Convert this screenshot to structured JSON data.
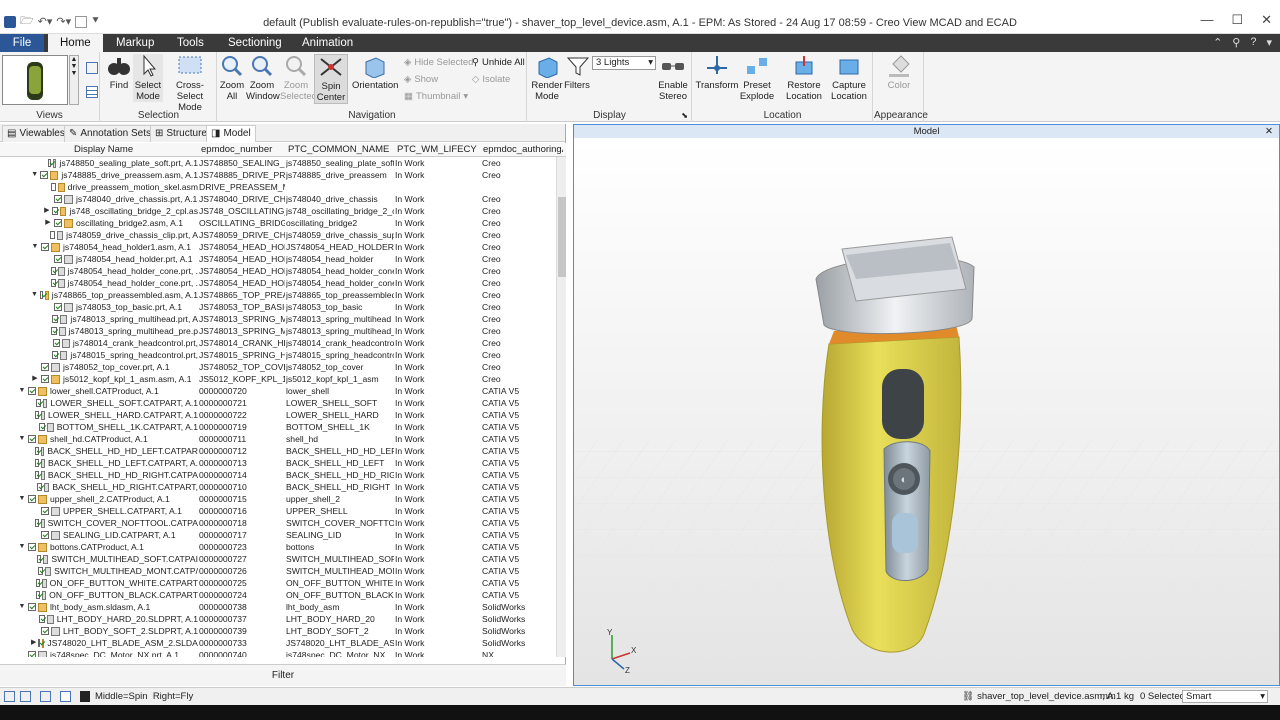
{
  "window": {
    "title": "default (Publish evaluate-rules-on-republish=\"true\") - shaver_top_level_device.asm, A.1 - EPM: As Stored - 24 Aug 17 08:59 - Creo View MCAD and ECAD"
  },
  "tabs": [
    "File",
    "Home",
    "Markup",
    "Tools",
    "Sectioning",
    "Animation"
  ],
  "ribbon": {
    "groups": [
      "Views",
      "Selection",
      "Navigation",
      "Display",
      "Location",
      "Appearance"
    ],
    "find": "Find",
    "select_mode": "Select Mode",
    "cross_select": "Cross-Select Mode",
    "zoom_all": "Zoom All",
    "zoom_window": "Zoom Window",
    "zoom_selected": "Zoom Selected",
    "spin_center": "Spin Center",
    "orientation": "Orientation",
    "hide_selected": "Hide Selected",
    "show": "Show",
    "thumbnail": "Thumbnail",
    "unhide_all": "Unhide All",
    "isolate": "Isolate",
    "render_mode": "Render Mode",
    "filters": "Filters",
    "lights_value": "3 Lights",
    "enable_stereo": "Enable Stereo",
    "transform": "Transform",
    "preset_explode": "Preset Explode",
    "restore_location": "Restore Location",
    "capture_location": "Capture Location",
    "color": "Color"
  },
  "panel": {
    "tabs": [
      "Viewables",
      "Annotation Sets",
      "Structure",
      "Model"
    ],
    "columns": [
      "Display Name",
      "epmdoc_number",
      "PTC_COMMON_NAME",
      "PTC_WM_LIFECYCL...",
      "epmdoc_authoringA..."
    ],
    "filter_label": "Filter"
  },
  "rows": [
    {
      "d": 2,
      "e": "",
      "cb": true,
      "t": "part",
      "n": "js748850_sealing_plate_soft.prt, A.1",
      "num": "JS748850_SEALING_PL...",
      "cn": "js748850_sealing_plate_soft",
      "lc": "In Work",
      "a": "Creo"
    },
    {
      "d": 1,
      "e": "▼",
      "cb": true,
      "t": "asm",
      "n": "js748885_drive_preassem.asm, A.1",
      "num": "JS748885_DRIVE_PREA...",
      "cn": "js748885_drive_preassem",
      "lc": "In Work",
      "a": "Creo"
    },
    {
      "d": 2,
      "e": "",
      "cb": false,
      "t": "asm",
      "n": "drive_preassem_motion_skel.asm",
      "num": "DRIVE_PREASSEM_MO...",
      "cn": "",
      "lc": "",
      "a": ""
    },
    {
      "d": 2,
      "e": "",
      "cb": true,
      "t": "part",
      "n": "js748040_drive_chassis.prt, A.1",
      "num": "JS748040_DRIVE_CHAS...",
      "cn": "js748040_drive_chassis",
      "lc": "In Work",
      "a": "Creo"
    },
    {
      "d": 2,
      "e": "▶",
      "cb": true,
      "t": "asm",
      "n": "js748_oscillating_bridge_2_cpl.as",
      "num": "JS748_OSCILLATING_B...",
      "cn": "js748_oscillating_bridge_2_cpl",
      "lc": "In Work",
      "a": "Creo"
    },
    {
      "d": 2,
      "e": "▶",
      "cb": true,
      "t": "asm",
      "n": "oscillating_bridge2.asm, A.1",
      "num": "OSCILLATING_BRIDGE2",
      "cn": "oscillating_bridge2",
      "lc": "In Work",
      "a": "Creo"
    },
    {
      "d": 2,
      "e": "",
      "cb": false,
      "t": "part",
      "n": "js748059_drive_chassis_clip.prt, A",
      "num": "JS748059_DRIVE_CHAS...",
      "cn": "js748059_drive_chassis_supp...",
      "lc": "In Work",
      "a": "Creo"
    },
    {
      "d": 1,
      "e": "▼",
      "cb": true,
      "t": "asm",
      "n": "js748054_head_holder1.asm, A.1",
      "num": "JS748054_HEAD_HOLD...",
      "cn": "JS748054_HEAD_HOLDER1.A...",
      "lc": "In Work",
      "a": "Creo"
    },
    {
      "d": 2,
      "e": "",
      "cb": true,
      "t": "part",
      "n": "js748054_head_holder.prt, A.1",
      "num": "JS748054_HEAD_HOLD...",
      "cn": "js748054_head_holder",
      "lc": "In Work",
      "a": "Creo"
    },
    {
      "d": 2,
      "e": "",
      "cb": true,
      "t": "part",
      "n": "js748054_head_holder_cone.prt, .",
      "num": "JS748054_HEAD_HOLD...",
      "cn": "js748054_head_holder_cone",
      "lc": "In Work",
      "a": "Creo"
    },
    {
      "d": 2,
      "e": "",
      "cb": true,
      "t": "part",
      "n": "js748054_head_holder_cone.prt, .",
      "num": "JS748054_HEAD_HOLD...",
      "cn": "js748054_head_holder_cone",
      "lc": "In Work",
      "a": "Creo"
    },
    {
      "d": 1,
      "e": "▼",
      "cb": true,
      "t": "asm",
      "n": "js748865_top_preassembled.asm, A.1",
      "num": "JS748865_TOP_PREASS...",
      "cn": "js748865_top_preassembled",
      "lc": "In Work",
      "a": "Creo"
    },
    {
      "d": 2,
      "e": "",
      "cb": true,
      "t": "part",
      "n": "js748053_top_basic.prt, A.1",
      "num": "JS748053_TOP_BASIC",
      "cn": "js748053_top_basic",
      "lc": "In Work",
      "a": "Creo"
    },
    {
      "d": 2,
      "e": "",
      "cb": true,
      "t": "part",
      "n": "js748013_spring_multihead.prt, A",
      "num": "JS748013_SPRING_MU...",
      "cn": "js748013_spring_multihead",
      "lc": "In Work",
      "a": "Creo"
    },
    {
      "d": 2,
      "e": "",
      "cb": true,
      "t": "part",
      "n": "js748013_spring_multihead_pre.p",
      "num": "JS748013_SPRING_MU...",
      "cn": "js748013_spring_multihead_...",
      "lc": "In Work",
      "a": "Creo"
    },
    {
      "d": 2,
      "e": "",
      "cb": true,
      "t": "part",
      "n": "js748014_crank_headcontrol.prt,",
      "num": "JS748014_CRANK_HEA...",
      "cn": "js748014_crank_headcontrol",
      "lc": "In Work",
      "a": "Creo"
    },
    {
      "d": 2,
      "e": "",
      "cb": true,
      "t": "part",
      "n": "js748015_spring_headcontrol.prt,",
      "num": "JS748015_SPRING_HEA...",
      "cn": "js748015_spring_headcontrol",
      "lc": "In Work",
      "a": "Creo"
    },
    {
      "d": 1,
      "e": "",
      "cb": true,
      "t": "part",
      "n": "js748052_top_cover.prt, A.1",
      "num": "JS748052_TOP_COVER",
      "cn": "js748052_top_cover",
      "lc": "In Work",
      "a": "Creo"
    },
    {
      "d": 1,
      "e": "▶",
      "cb": true,
      "t": "asm",
      "n": "js5012_kopf_kpl_1_asm.asm, A.1",
      "num": "JS5012_KOPF_KPL_1_A...",
      "cn": "js5012_kopf_kpl_1_asm",
      "lc": "In Work",
      "a": "Creo"
    },
    {
      "d": 0,
      "e": "▼",
      "cb": true,
      "t": "asm",
      "n": "lower_shell.CATProduct, A.1",
      "num": "0000000720",
      "cn": "lower_shell",
      "lc": "In Work",
      "a": "CATIA V5"
    },
    {
      "d": 1,
      "e": "",
      "cb": true,
      "t": "part",
      "n": "LOWER_SHELL_SOFT.CATPART, A.1",
      "num": "0000000721",
      "cn": "LOWER_SHELL_SOFT",
      "lc": "In Work",
      "a": "CATIA V5"
    },
    {
      "d": 1,
      "e": "",
      "cb": true,
      "t": "part",
      "n": "LOWER_SHELL_HARD.CATPART, A.1",
      "num": "0000000722",
      "cn": "LOWER_SHELL_HARD",
      "lc": "In Work",
      "a": "CATIA V5"
    },
    {
      "d": 1,
      "e": "",
      "cb": true,
      "t": "part",
      "n": "BOTTOM_SHELL_1K.CATPART, A.1",
      "num": "0000000719",
      "cn": "BOTTOM_SHELL_1K",
      "lc": "In Work",
      "a": "CATIA V5"
    },
    {
      "d": 0,
      "e": "▼",
      "cb": true,
      "t": "asm",
      "n": "shell_hd.CATProduct, A.1",
      "num": "0000000711",
      "cn": "shell_hd",
      "lc": "In Work",
      "a": "CATIA V5"
    },
    {
      "d": 1,
      "e": "",
      "cb": true,
      "t": "part",
      "n": "BACK_SHELL_HD_HD_LEFT.CATPAR",
      "num": "0000000712",
      "cn": "BACK_SHELL_HD_HD_LEFT",
      "lc": "In Work",
      "a": "CATIA V5"
    },
    {
      "d": 1,
      "e": "",
      "cb": true,
      "t": "part",
      "n": "BACK_SHELL_HD_LEFT.CATPART, A.",
      "num": "0000000713",
      "cn": "BACK_SHELL_HD_LEFT",
      "lc": "In Work",
      "a": "CATIA V5"
    },
    {
      "d": 1,
      "e": "",
      "cb": true,
      "t": "part",
      "n": "BACK_SHELL_HD_HD_RIGHT.CATPA",
      "num": "0000000714",
      "cn": "BACK_SHELL_HD_HD_RIGHT",
      "lc": "In Work",
      "a": "CATIA V5"
    },
    {
      "d": 1,
      "e": "",
      "cb": true,
      "t": "part",
      "n": "BACK_SHELL_HD_RIGHT.CATPART,",
      "num": "0000000710",
      "cn": "BACK_SHELL_HD_RIGHT",
      "lc": "In Work",
      "a": "CATIA V5"
    },
    {
      "d": 0,
      "e": "▼",
      "cb": true,
      "t": "asm",
      "n": "upper_shell_2.CATProduct, A.1",
      "num": "0000000715",
      "cn": "upper_shell_2",
      "lc": "In Work",
      "a": "CATIA V5"
    },
    {
      "d": 1,
      "e": "",
      "cb": true,
      "t": "part",
      "n": "UPPER_SHELL.CATPART, A.1",
      "num": "0000000716",
      "cn": "UPPER_SHELL",
      "lc": "In Work",
      "a": "CATIA V5"
    },
    {
      "d": 1,
      "e": "",
      "cb": true,
      "t": "part",
      "n": "SWITCH_COVER_NOFTTOOL.CATPA",
      "num": "0000000718",
      "cn": "SWITCH_COVER_NOFTTOOL",
      "lc": "In Work",
      "a": "CATIA V5"
    },
    {
      "d": 1,
      "e": "",
      "cb": true,
      "t": "part",
      "n": "SEALING_LID.CATPART, A.1",
      "num": "0000000717",
      "cn": "SEALING_LID",
      "lc": "In Work",
      "a": "CATIA V5"
    },
    {
      "d": 0,
      "e": "▼",
      "cb": true,
      "t": "asm",
      "n": "bottons.CATProduct, A.1",
      "num": "0000000723",
      "cn": "bottons",
      "lc": "In Work",
      "a": "CATIA V5"
    },
    {
      "d": 1,
      "e": "",
      "cb": true,
      "t": "part",
      "n": "SWITCH_MULTIHEAD_SOFT.CATPAI",
      "num": "0000000727",
      "cn": "SWITCH_MULTIHEAD_SOFT",
      "lc": "In Work",
      "a": "CATIA V5"
    },
    {
      "d": 1,
      "e": "",
      "cb": true,
      "t": "part",
      "n": "SWITCH_MULTIHEAD_MONT.CATP/",
      "num": "0000000726",
      "cn": "SWITCH_MULTIHEAD_MONT",
      "lc": "In Work",
      "a": "CATIA V5"
    },
    {
      "d": 1,
      "e": "",
      "cb": true,
      "t": "part",
      "n": "ON_OFF_BUTTON_WHITE.CATPART",
      "num": "0000000725",
      "cn": "ON_OFF_BUTTON_WHITE",
      "lc": "In Work",
      "a": "CATIA V5"
    },
    {
      "d": 1,
      "e": "",
      "cb": true,
      "t": "part",
      "n": "ON_OFF_BUTTON_BLACK.CATPART",
      "num": "0000000724",
      "cn": "ON_OFF_BUTTON_BLACK",
      "lc": "In Work",
      "a": "CATIA V5"
    },
    {
      "d": 0,
      "e": "▼",
      "cb": true,
      "t": "asm",
      "n": "lht_body_asm.sldasm, A.1",
      "num": "0000000738",
      "cn": "lht_body_asm",
      "lc": "In Work",
      "a": "SolidWorks"
    },
    {
      "d": 1,
      "e": "",
      "cb": true,
      "t": "part",
      "n": "LHT_BODY_HARD_20.SLDPRT, A.1",
      "num": "0000000737",
      "cn": "LHT_BODY_HARD_20",
      "lc": "In Work",
      "a": "SolidWorks"
    },
    {
      "d": 1,
      "e": "",
      "cb": true,
      "t": "part",
      "n": "LHT_BODY_SOFT_2.SLDPRT, A.1",
      "num": "0000000739",
      "cn": "LHT_BODY_SOFT_2",
      "lc": "In Work",
      "a": "SolidWorks"
    },
    {
      "d": 1,
      "e": "▶",
      "cb": true,
      "t": "asm",
      "n": "JS748020_LHT_BLADE_ASM_2.SLDAS",
      "num": "0000000733",
      "cn": "JS748020_LHT_BLADE_ASM_2",
      "lc": "In Work",
      "a": "SolidWorks"
    },
    {
      "d": 0,
      "e": "",
      "cb": true,
      "t": "part",
      "n": "js748spec_DC_Motor_NX.prt, A.1",
      "num": "0000000740",
      "cn": "js748spec_DC_Motor_NX",
      "lc": "In Work",
      "a": "NX"
    }
  ],
  "viewport": {
    "title": "Model",
    "axes": [
      "Y",
      "X",
      "Z"
    ]
  },
  "status": {
    "mouse_hint": "Middle=Spin  Right=Fly",
    "file": "shaver_top_level_device.asm, A.1",
    "unit_mm": "mm",
    "unit_kg": "kg",
    "selected": "0 Selected",
    "select_mode": "Smart"
  }
}
